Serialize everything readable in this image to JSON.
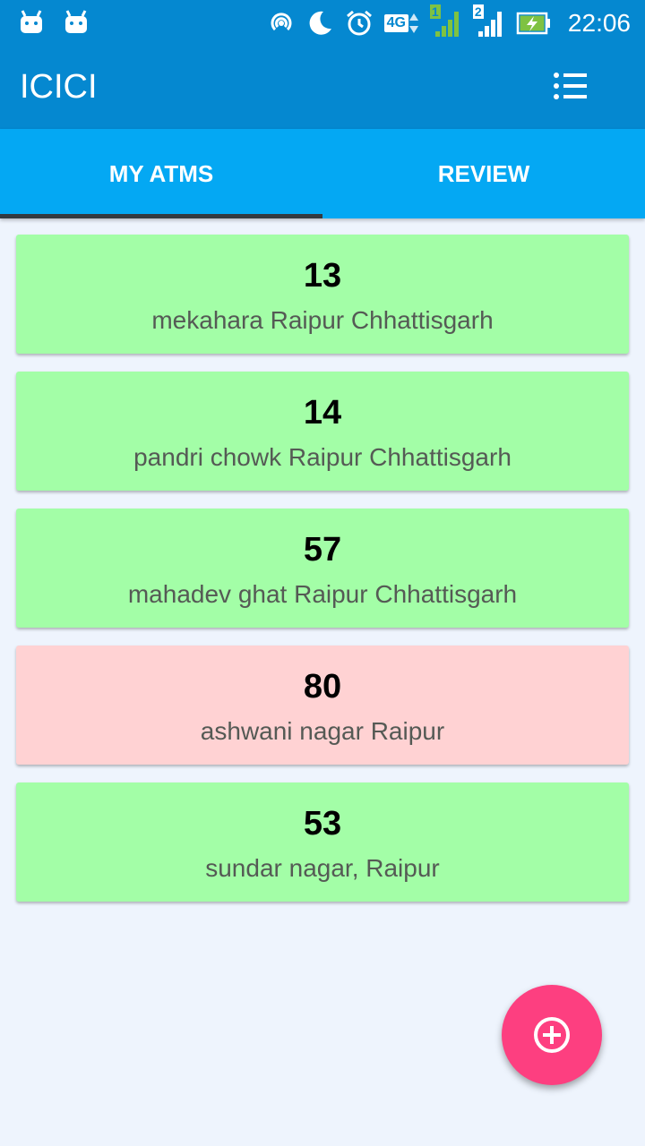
{
  "status_bar": {
    "time": "22:06",
    "network_label": "4G",
    "sim1_label": "1",
    "sim2_label": "2"
  },
  "app_bar": {
    "title": "ICICI"
  },
  "tabs": [
    {
      "label": "MY ATMS",
      "selected": true
    },
    {
      "label": "REVIEW",
      "selected": false
    }
  ],
  "atms": [
    {
      "number": "13",
      "address": "mekahara Raipur Chhattisgarh",
      "status_color": "#a3fea7"
    },
    {
      "number": "14",
      "address": "pandri chowk Raipur Chhattisgarh",
      "status_color": "#a3fea7"
    },
    {
      "number": "57",
      "address": "mahadev ghat Raipur Chhattisgarh",
      "status_color": "#a3fea7"
    },
    {
      "number": "80",
      "address": "ashwani nagar Raipur",
      "status_color": "#ffd2d3"
    },
    {
      "number": "53",
      "address": "sundar nagar, Raipur",
      "status_color": "#a3fea7"
    }
  ],
  "colors": {
    "app_bar": "#0588d0",
    "tab_bar": "#04a8f3",
    "fab": "#fd3f80",
    "background": "#eef4fd"
  },
  "icons": {
    "menu": "list-menu-icon",
    "fab": "add-circle-icon"
  }
}
